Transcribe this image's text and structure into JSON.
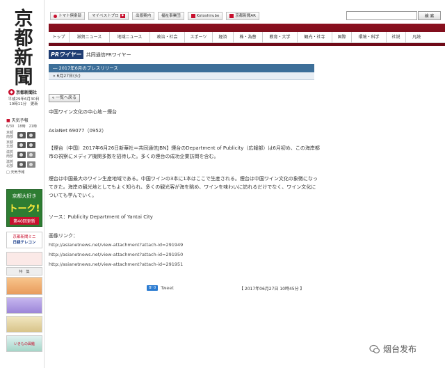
{
  "masthead": {
    "char1": "京",
    "char2": "都",
    "char3": "新",
    "char4": "聞"
  },
  "sidebar": {
    "publisher_logo": "京都新聞社",
    "date_line1": "平成29年6月30日",
    "date_line2": "19時11分　更新",
    "weather_title": "天気予報",
    "weather_head": "6/30　18時　21時",
    "weather_rows": [
      "京都南部",
      "京都北部",
      "滋賀南部",
      "滋賀北部"
    ],
    "weather_more": "天気予報",
    "ad_talk": {
      "line1": "京都大好き",
      "line2": "トーク!",
      "line3": "第40回更新"
    },
    "ad_telecon": {
      "line1": "京都新聞ミニ",
      "line2": "日経テレコン"
    },
    "ad_b": "特　集",
    "ad_f": "いきもの図鑑"
  },
  "topbar": {
    "buttons": [
      "トマト倶楽部",
      "マイベストプロ",
      "出版案内",
      "福祉事業団",
      "Kotoshirube",
      "京都新聞AR"
    ],
    "search_placeholder": "",
    "search_label": "検 索"
  },
  "nav": {
    "items": [
      "トップ",
      "滋賀ニュース",
      "地域ニュース",
      "政治・社会",
      "スポーツ",
      "経済",
      "株・為替",
      "教育・大学",
      "観光・社寺",
      "国際",
      "環境・科学",
      "社説",
      "凡読"
    ]
  },
  "pr": {
    "logo": "PRワイヤー",
    "subtitle": "共同通信PRワイヤー",
    "section": "― 2017年6月のプレスリリース",
    "date": "» 6月27日(火)"
  },
  "back_label": "« 一覧へ戻る",
  "article": {
    "title": "中国ワイン文化の中心地－煙台",
    "release_id": "AsiaNet 69077（0952）",
    "paragraph1": "【煙台（中国）2017年6月26日新華社＝共同通信JBN】煙台のDepartment of Publicity（広報部）は6月初め、この海岸都市の視察にメディア機関多数を招待した。多くの煙台の成功企業訪問を含む。",
    "paragraph2": "煙台は中国最大のワイン生産地域である。中国ワインの3本に1本はここで生産される。煙台は中国ワイン文化の象徴になってきた。海岸の観光地としてもよく知られ、多くの観光客が海を眺め、ワインを味わいに訪れるだけでなく、ワイン文化についても学んでいく。",
    "source": "ソース：Publicity Department of Yantai City",
    "image_label": "画像リンク：",
    "links": [
      "http://asianetnews.net/view-attachment?attach-id=291949",
      "http://asianetnews.net/view-attachment?attach-id=291950",
      "http://asianetnews.net/view-attachment?attach-id=291951"
    ]
  },
  "share": {
    "b_button": "B! 0",
    "tweet": "Tweet"
  },
  "timestamp": "【 2017年06月27日 10時45分 】",
  "watermark": "烟台发布",
  "colors": {
    "nav_bar": "#8b0f1e",
    "section_bar": "#3d6f99",
    "brand_red": "#c8102e"
  }
}
